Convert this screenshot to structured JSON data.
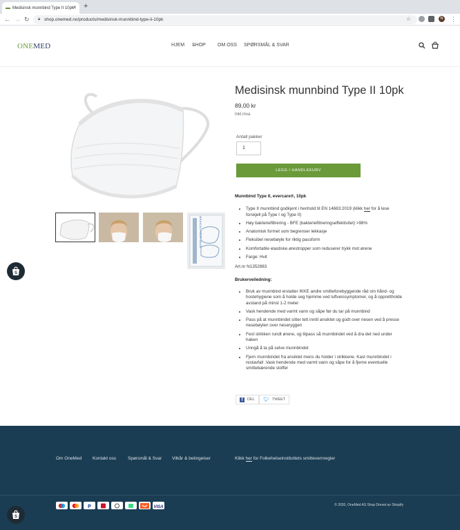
{
  "browser": {
    "tab_title": "Medisinsk munnbind Type II 10pk",
    "url": "shop.onemed.no/products/medisinsk-munnbind-type-ii-10pk",
    "profile_initial": "N"
  },
  "site": {
    "logo_one": "ONE",
    "logo_med": "MED",
    "nav": [
      "HJEM",
      "SHOP",
      "OM OSS",
      "SPØRSMÅL & SVAR"
    ]
  },
  "product": {
    "title": "Medisinsk munnbind Type II 10pk",
    "price": "89,00 kr",
    "vat": "Inkl.mva",
    "quantity_label": "Antall pakker",
    "quantity_value": "1",
    "add_to_cart": "LEGG I HANDLEKURV",
    "subtitle": "Munnbind Type II, evercare®, 10pk",
    "features": [
      "Type II munnbind godkjent i henhold til EN 14683:2019 (klikk her for å lese forskjell på Type I og Type II)",
      "Høy bakteriefiltrering - BFE (bakteriefiltreringseffektivitet) >98%",
      "Anatomisk formet som begrenser lekkasje",
      "Fleksibel nesebøyle for riktig passform",
      "Komfortable elastiske ørestropper som reduserer trykk mot ørene",
      "Farge: Hvit"
    ],
    "art_nr": "Art.nr N1352883",
    "guide_heading": "Brukerveiledning:",
    "guide": [
      "Bruk av munnbind erstatter IKKE andre smitteforebyggende råd om hånd- og hostehygiene som å holde seg hjemme ved luftveissymptomer, og å opprettholde avstand på minst 1-2 meter",
      "Vask hendende med varmt vann og såpe før du tar på munnbind",
      "Pass på at munnbindet sitter tett inntil ansiktet og godt over nesen ved å presse nesebøylen over neseryggen",
      "Fest strikken rundt ørene, og tilpass så munnbindet ved å dra det ned under haken",
      "Unngå å ta på selve munnbindet",
      "Fjern munnbindet fra ansiktet mens du holder i strikkene. Kast munnbindet i restavfall .Vask hendende med varmt vann og såpe for å fjerne eventuelle smittebærende stoffer"
    ],
    "share_label": "DEL",
    "tweet_label": "TWEET",
    "thumb_box_text": "MEDICAL FACE MASK"
  },
  "footer": {
    "links": [
      "Om OneMed",
      "Kontakt oss",
      "Spørsmål & Svar",
      "Vilkår & betingelser"
    ],
    "fhi_pre": "Klikk ",
    "fhi_link": "her",
    "fhi_post": " for Folkehelseinstituttets smittevernregler",
    "payments": [
      "maestro",
      "mastercard",
      "paypal",
      "bankaxept",
      "apple-pay",
      "google-pay",
      "vipps",
      "visa"
    ],
    "copyright": "© 2020, OneMed AS Shop Drevet av Shopify"
  },
  "colors": {
    "accent": "#6a9a3a",
    "footer_bg": "#1b3d53",
    "logo": "#2a3a5e"
  }
}
